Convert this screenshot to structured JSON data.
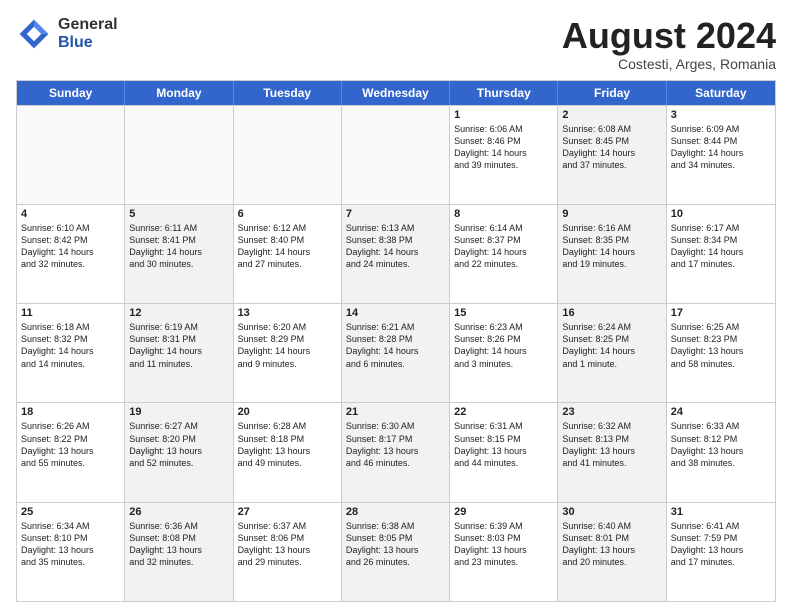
{
  "logo": {
    "general": "General",
    "blue": "Blue"
  },
  "title": "August 2024",
  "subtitle": "Costesti, Arges, Romania",
  "days": [
    "Sunday",
    "Monday",
    "Tuesday",
    "Wednesday",
    "Thursday",
    "Friday",
    "Saturday"
  ],
  "rows": [
    [
      {
        "day": "",
        "text": "",
        "empty": true
      },
      {
        "day": "",
        "text": "",
        "empty": true
      },
      {
        "day": "",
        "text": "",
        "empty": true
      },
      {
        "day": "",
        "text": "",
        "empty": true
      },
      {
        "day": "1",
        "text": "Sunrise: 6:06 AM\nSunset: 8:46 PM\nDaylight: 14 hours\nand 39 minutes."
      },
      {
        "day": "2",
        "text": "Sunrise: 6:08 AM\nSunset: 8:45 PM\nDaylight: 14 hours\nand 37 minutes.",
        "shaded": true
      },
      {
        "day": "3",
        "text": "Sunrise: 6:09 AM\nSunset: 8:44 PM\nDaylight: 14 hours\nand 34 minutes."
      }
    ],
    [
      {
        "day": "4",
        "text": "Sunrise: 6:10 AM\nSunset: 8:42 PM\nDaylight: 14 hours\nand 32 minutes."
      },
      {
        "day": "5",
        "text": "Sunrise: 6:11 AM\nSunset: 8:41 PM\nDaylight: 14 hours\nand 30 minutes.",
        "shaded": true
      },
      {
        "day": "6",
        "text": "Sunrise: 6:12 AM\nSunset: 8:40 PM\nDaylight: 14 hours\nand 27 minutes."
      },
      {
        "day": "7",
        "text": "Sunrise: 6:13 AM\nSunset: 8:38 PM\nDaylight: 14 hours\nand 24 minutes.",
        "shaded": true
      },
      {
        "day": "8",
        "text": "Sunrise: 6:14 AM\nSunset: 8:37 PM\nDaylight: 14 hours\nand 22 minutes."
      },
      {
        "day": "9",
        "text": "Sunrise: 6:16 AM\nSunset: 8:35 PM\nDaylight: 14 hours\nand 19 minutes.",
        "shaded": true
      },
      {
        "day": "10",
        "text": "Sunrise: 6:17 AM\nSunset: 8:34 PM\nDaylight: 14 hours\nand 17 minutes."
      }
    ],
    [
      {
        "day": "11",
        "text": "Sunrise: 6:18 AM\nSunset: 8:32 PM\nDaylight: 14 hours\nand 14 minutes."
      },
      {
        "day": "12",
        "text": "Sunrise: 6:19 AM\nSunset: 8:31 PM\nDaylight: 14 hours\nand 11 minutes.",
        "shaded": true
      },
      {
        "day": "13",
        "text": "Sunrise: 6:20 AM\nSunset: 8:29 PM\nDaylight: 14 hours\nand 9 minutes."
      },
      {
        "day": "14",
        "text": "Sunrise: 6:21 AM\nSunset: 8:28 PM\nDaylight: 14 hours\nand 6 minutes.",
        "shaded": true
      },
      {
        "day": "15",
        "text": "Sunrise: 6:23 AM\nSunset: 8:26 PM\nDaylight: 14 hours\nand 3 minutes."
      },
      {
        "day": "16",
        "text": "Sunrise: 6:24 AM\nSunset: 8:25 PM\nDaylight: 14 hours\nand 1 minute.",
        "shaded": true
      },
      {
        "day": "17",
        "text": "Sunrise: 6:25 AM\nSunset: 8:23 PM\nDaylight: 13 hours\nand 58 minutes."
      }
    ],
    [
      {
        "day": "18",
        "text": "Sunrise: 6:26 AM\nSunset: 8:22 PM\nDaylight: 13 hours\nand 55 minutes."
      },
      {
        "day": "19",
        "text": "Sunrise: 6:27 AM\nSunset: 8:20 PM\nDaylight: 13 hours\nand 52 minutes.",
        "shaded": true
      },
      {
        "day": "20",
        "text": "Sunrise: 6:28 AM\nSunset: 8:18 PM\nDaylight: 13 hours\nand 49 minutes."
      },
      {
        "day": "21",
        "text": "Sunrise: 6:30 AM\nSunset: 8:17 PM\nDaylight: 13 hours\nand 46 minutes.",
        "shaded": true
      },
      {
        "day": "22",
        "text": "Sunrise: 6:31 AM\nSunset: 8:15 PM\nDaylight: 13 hours\nand 44 minutes."
      },
      {
        "day": "23",
        "text": "Sunrise: 6:32 AM\nSunset: 8:13 PM\nDaylight: 13 hours\nand 41 minutes.",
        "shaded": true
      },
      {
        "day": "24",
        "text": "Sunrise: 6:33 AM\nSunset: 8:12 PM\nDaylight: 13 hours\nand 38 minutes."
      }
    ],
    [
      {
        "day": "25",
        "text": "Sunrise: 6:34 AM\nSunset: 8:10 PM\nDaylight: 13 hours\nand 35 minutes."
      },
      {
        "day": "26",
        "text": "Sunrise: 6:36 AM\nSunset: 8:08 PM\nDaylight: 13 hours\nand 32 minutes.",
        "shaded": true
      },
      {
        "day": "27",
        "text": "Sunrise: 6:37 AM\nSunset: 8:06 PM\nDaylight: 13 hours\nand 29 minutes."
      },
      {
        "day": "28",
        "text": "Sunrise: 6:38 AM\nSunset: 8:05 PM\nDaylight: 13 hours\nand 26 minutes.",
        "shaded": true
      },
      {
        "day": "29",
        "text": "Sunrise: 6:39 AM\nSunset: 8:03 PM\nDaylight: 13 hours\nand 23 minutes."
      },
      {
        "day": "30",
        "text": "Sunrise: 6:40 AM\nSunset: 8:01 PM\nDaylight: 13 hours\nand 20 minutes.",
        "shaded": true
      },
      {
        "day": "31",
        "text": "Sunrise: 6:41 AM\nSunset: 7:59 PM\nDaylight: 13 hours\nand 17 minutes."
      }
    ]
  ]
}
